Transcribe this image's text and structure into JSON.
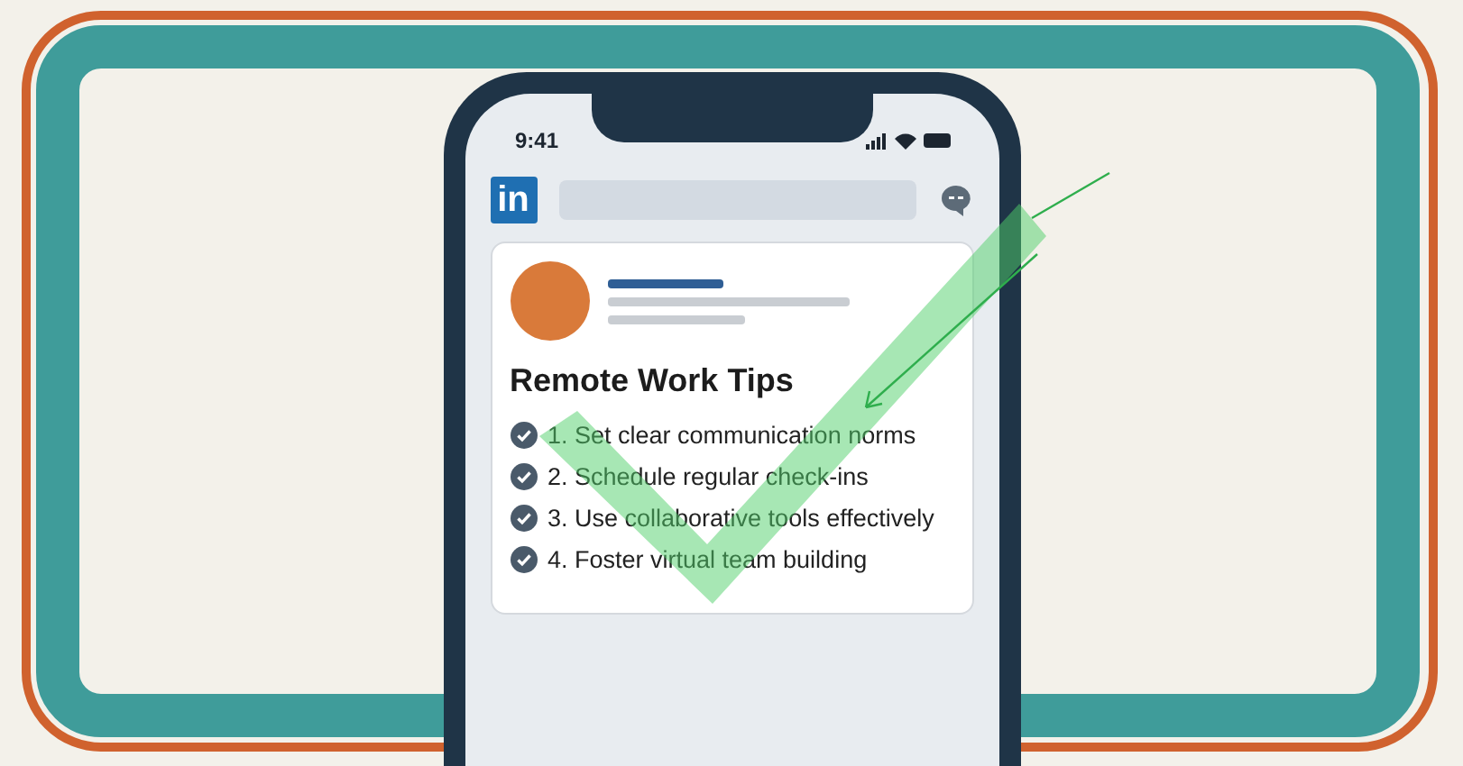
{
  "status_bar": {
    "time": "9:41"
  },
  "app_bar": {
    "logo": "in"
  },
  "post": {
    "title": "Remote Work Tips",
    "items": [
      {
        "text": "1. Set clear communication norms",
        "checked": true
      },
      {
        "text": "2. Schedule regular check-ins",
        "checked": true
      },
      {
        "text": "3. Use collaborative tools effectively",
        "checked": true
      },
      {
        "text": "4. Foster virtual team building",
        "checked": true
      }
    ]
  }
}
